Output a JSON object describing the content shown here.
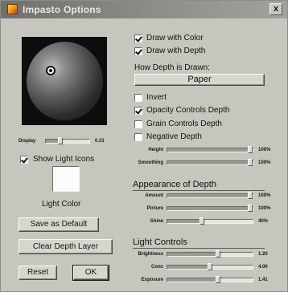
{
  "window": {
    "title": "Impasto Options",
    "close_label": "x"
  },
  "preview": {
    "display_label": "Display",
    "display_value": "0.31",
    "display_fraction": 0.31
  },
  "show_light_icons": {
    "label": "Show Light Icons",
    "checked": true
  },
  "light_color": {
    "label": "Light Color",
    "color": "#fbfbfb"
  },
  "buttons": {
    "save_default": "Save as Default",
    "clear_depth": "Clear Depth Layer",
    "reset": "Reset",
    "ok": "OK"
  },
  "draw_options": {
    "draw_with_color": {
      "label": "Draw with Color",
      "checked": true
    },
    "draw_with_depth": {
      "label": "Draw with Depth",
      "checked": true
    }
  },
  "how_depth": {
    "heading": "How Depth is Drawn:",
    "selected": "Paper"
  },
  "depth_options": [
    {
      "label": "Invert",
      "checked": false
    },
    {
      "label": "Opacity Controls Depth",
      "checked": true
    },
    {
      "label": "Grain Controls Depth",
      "checked": false
    },
    {
      "label": "Negative Depth",
      "checked": false
    }
  ],
  "depth_sliders": [
    {
      "label": "Height",
      "value": "100%",
      "fraction": 1.0
    },
    {
      "label": "Smoothing",
      "value": "100%",
      "fraction": 1.0
    }
  ],
  "appearance": {
    "heading": "Appearance of Depth",
    "sliders": [
      {
        "label": "Amount",
        "value": "100%",
        "fraction": 1.0
      },
      {
        "label": "Picture",
        "value": "100%",
        "fraction": 1.0
      },
      {
        "label": "Shine",
        "value": "40%",
        "fraction": 0.4
      }
    ]
  },
  "light_controls": {
    "heading": "Light Controls",
    "sliders": [
      {
        "label": "Brightness",
        "value": "1.20",
        "fraction": 0.6
      },
      {
        "label": "Conc",
        "value": "4.00",
        "fraction": 0.5
      },
      {
        "label": "Exposure",
        "value": "1.41",
        "fraction": 0.6
      }
    ]
  }
}
